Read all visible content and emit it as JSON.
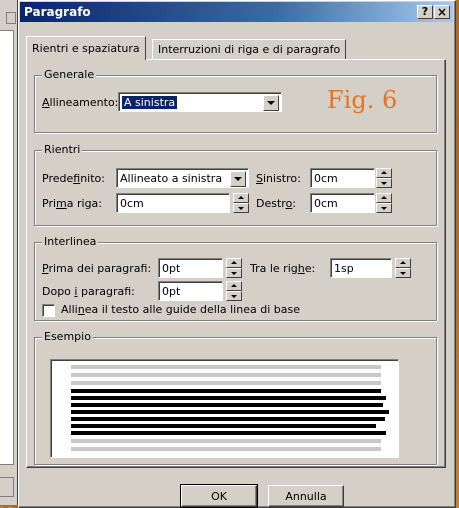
{
  "dialog": {
    "title": "Paragrafo",
    "help_label": "?",
    "close_label": "×"
  },
  "tabs": [
    {
      "label": "Rientri e spaziatura",
      "active": true
    },
    {
      "label": "Interruzioni di riga e di paragrafo",
      "active": false
    }
  ],
  "generale": {
    "title": "Generale",
    "allineamento": {
      "prefix": "A",
      "label_rest": "llineamento:",
      "value": "A sinistra"
    }
  },
  "figure_label": "Fig. 6",
  "rientri": {
    "title": "Rientri",
    "predefinito": {
      "pre": "Prede",
      "key": "f",
      "post": "inito:",
      "value": "Allineato a sinistra"
    },
    "prima_riga": {
      "pre": "Pri",
      "key": "m",
      "post": "a riga:",
      "value": "0cm"
    },
    "sinistro": {
      "pre": "",
      "key": "S",
      "post": "inistro:",
      "value": "0cm"
    },
    "destro": {
      "pre": "Destr",
      "key": "o",
      "post": ":",
      "value": "0cm"
    }
  },
  "interlinea": {
    "title": "Interlinea",
    "prima_paragrafi": {
      "pre": "",
      "key": "P",
      "post": "rima dei paragrafi:",
      "value": "0pt"
    },
    "dopo_paragrafi": {
      "pre": "Dopo ",
      "key": "i",
      "post": " paragrafi:",
      "value": "0pt"
    },
    "tra_righe": {
      "pre": "Tra le rig",
      "key": "h",
      "post": "e:",
      "value": "1sp"
    },
    "allinea_checkbox": {
      "pre": "Alli",
      "key": "n",
      "post": "ea il testo alle guide della linea di base",
      "checked": false
    }
  },
  "esempio": {
    "title": "Esempio"
  },
  "buttons": {
    "ok": "OK",
    "cancel": "Annulla"
  },
  "colors": {
    "titlebar_start": "#0a246a",
    "titlebar_end": "#a6caf0",
    "figure_label": "#e8731a",
    "dialog_face": "#d4d0c8"
  }
}
